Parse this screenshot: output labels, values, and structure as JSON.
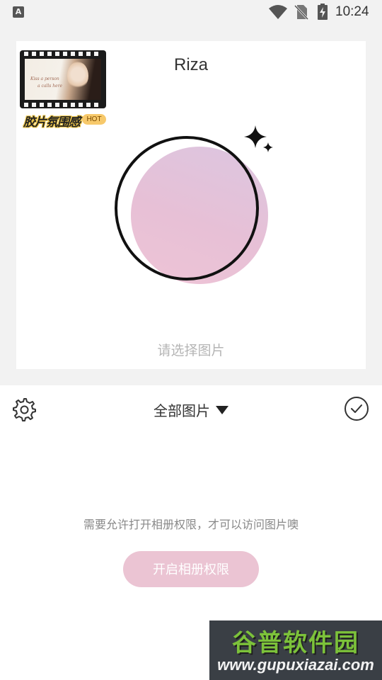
{
  "status_bar": {
    "app_icon_letter": "A",
    "time": "10:24",
    "icons": [
      "wifi-icon",
      "no-sim-icon",
      "battery-charging-icon"
    ]
  },
  "preview": {
    "username": "Riza",
    "promo": {
      "caption": "胶片氛围感",
      "badge": "HOT",
      "film_script_1": "Kiss a person",
      "film_script_2": "a calls here"
    },
    "avatar_colors": {
      "blob_start": "#dcc6e0",
      "blob_end": "#eec4d6",
      "ring": "#111111"
    },
    "hint": "请选择图片"
  },
  "toolbar": {
    "settings_icon": "gear-icon",
    "album_label": "全部图片",
    "dropdown_icon": "triangle-down-icon",
    "confirm_icon": "check-circle-icon"
  },
  "permission": {
    "message": "需要允许打开相册权限，才可以访问图片噢",
    "button_label": "开启相册权限",
    "button_color": "#ebc4d3"
  },
  "watermark": {
    "title": "谷普软件园",
    "url": "www.gupuxiazai.com"
  }
}
